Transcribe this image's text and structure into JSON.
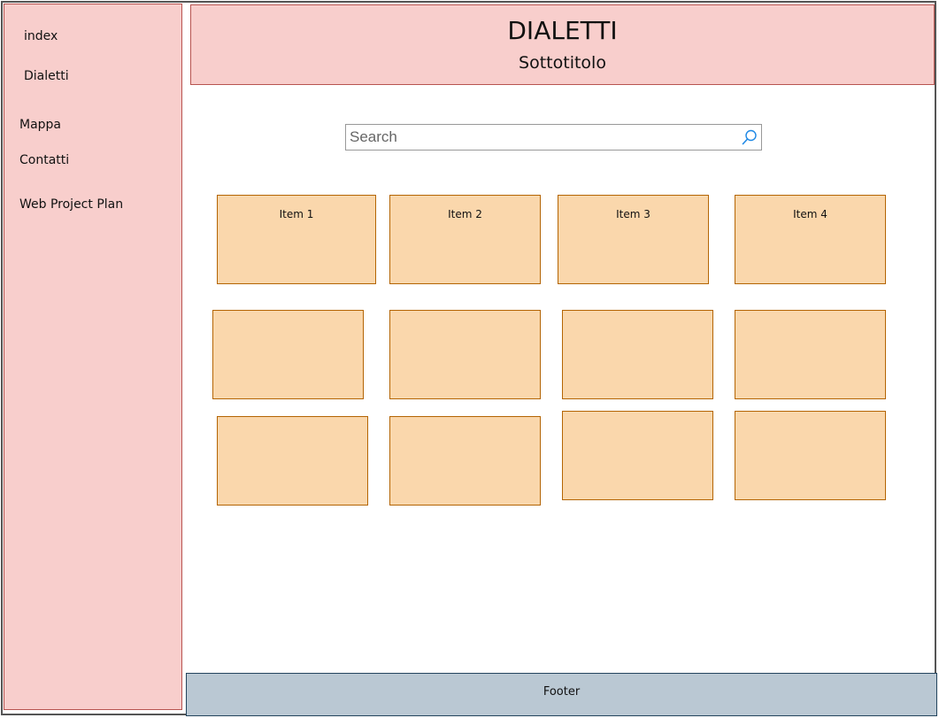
{
  "sidebar": {
    "items": [
      {
        "label": "index"
      },
      {
        "label": "Dialetti"
      },
      {
        "label": "Mappa"
      },
      {
        "label": "Contatti"
      },
      {
        "label": "Web Project Plan"
      }
    ]
  },
  "header": {
    "title": "DIALETTI",
    "subtitle": "Sottotitolo"
  },
  "search": {
    "placeholder": "Search",
    "value": ""
  },
  "grid": {
    "items": [
      {
        "label": "Item 1"
      },
      {
        "label": "Item 2"
      },
      {
        "label": "Item 3"
      },
      {
        "label": "Item 4"
      },
      {
        "label": ""
      },
      {
        "label": ""
      },
      {
        "label": ""
      },
      {
        "label": ""
      },
      {
        "label": ""
      },
      {
        "label": ""
      },
      {
        "label": ""
      },
      {
        "label": ""
      }
    ]
  },
  "footer": {
    "label": "Footer"
  },
  "colors": {
    "sidebar_bg": "#f8cecc",
    "header_bg": "#f8cecc",
    "card_bg": "#fad7ac",
    "footer_bg": "#bac8d3",
    "search_icon": "#1e88e5"
  },
  "icons": {
    "search": "search-icon"
  }
}
